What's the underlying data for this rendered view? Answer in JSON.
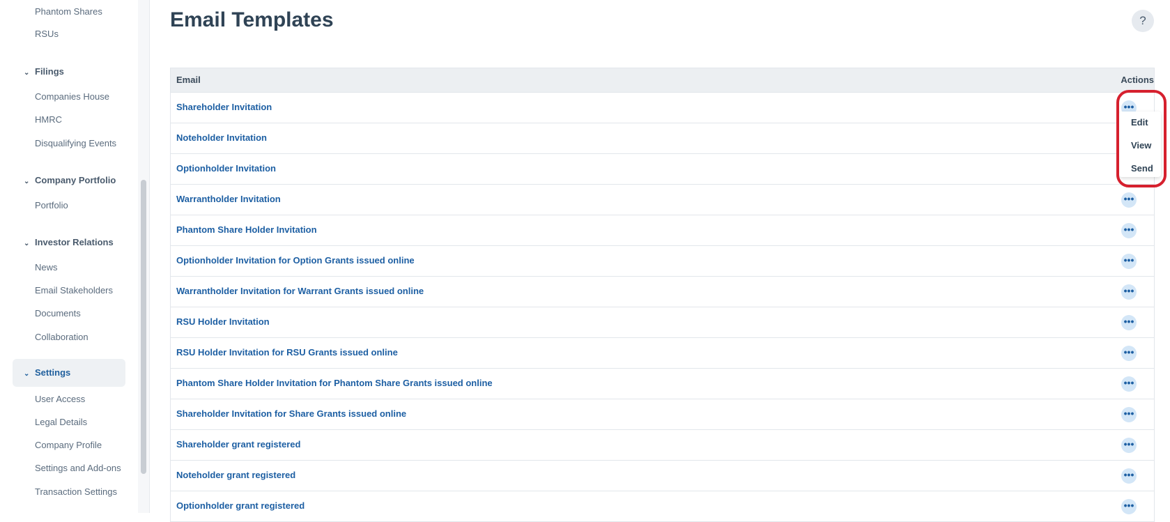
{
  "sidebar": {
    "top_links": [
      "Phantom Shares",
      "RSUs"
    ],
    "sections": [
      {
        "title": "Filings",
        "items": [
          "Companies House",
          "HMRC",
          "Disqualifying Events"
        ]
      },
      {
        "title": "Company Portfolio",
        "items": [
          "Portfolio"
        ]
      },
      {
        "title": "Investor Relations",
        "items": [
          "News",
          "Email Stakeholders",
          "Documents",
          "Collaboration"
        ]
      },
      {
        "title": "Settings",
        "items": [
          "User Access",
          "Legal Details",
          "Company Profile",
          "Settings and Add-ons",
          "Transaction Settings"
        ]
      }
    ],
    "chevron": "⌄"
  },
  "page": {
    "title": "Email Templates",
    "help": "?"
  },
  "table": {
    "headers": {
      "email": "Email",
      "actions": "Actions"
    },
    "rows": [
      "Shareholder Invitation",
      "Noteholder Invitation",
      "Optionholder Invitation",
      "Warrantholder Invitation",
      "Phantom Share Holder Invitation",
      "Optionholder Invitation for Option Grants issued online",
      "Warrantholder Invitation for Warrant Grants issued online",
      "RSU Holder Invitation",
      "RSU Holder Invitation for RSU Grants issued online",
      "Phantom Share Holder Invitation for Phantom Share Grants issued online",
      "Shareholder Invitation for Share Grants issued online",
      "Shareholder grant registered",
      "Noteholder grant registered",
      "Optionholder grant registered"
    ],
    "dots": "•••"
  },
  "dropdown": {
    "items": [
      "Edit",
      "View",
      "Send"
    ]
  },
  "colors": {
    "link": "#1d5fa3",
    "highlight": "#d6202e",
    "header_bg": "#eceff2"
  }
}
